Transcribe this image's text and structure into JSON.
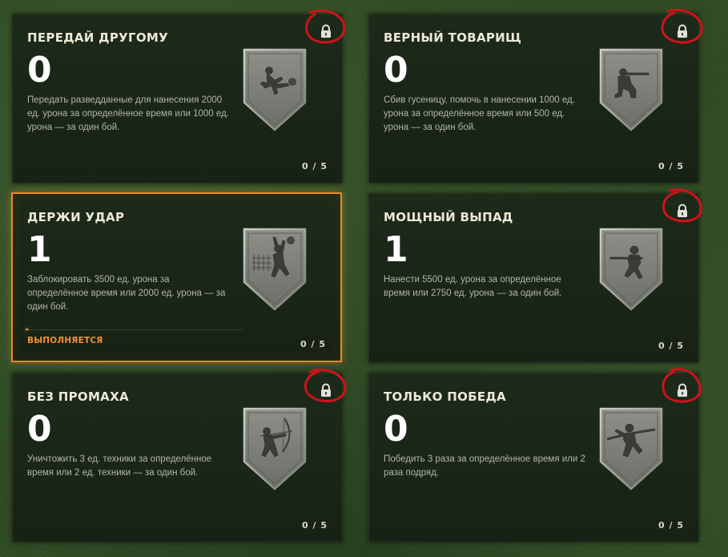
{
  "colors": {
    "background": "#2f4a24",
    "card": "#1b2718",
    "accent_active": "#e8892a",
    "status_text": "#f28f3a",
    "annotation_circle": "#d0121a"
  },
  "cards": [
    {
      "title": "ПЕРЕДАЙ ДРУГОМУ",
      "count": "0",
      "description": "Передать разведданные для нанесения 2000 ед. урона за определённое время или 1000 ед. урона — за один бой.",
      "progress": "0 / 5",
      "badge_icon": "football-kicker-icon",
      "locked": true
    },
    {
      "title": "ВЕРНЫЙ ТОВАРИЩ",
      "count": "0",
      "description": "Сбив гусеницу, помочь в нанесении 1000 ед. урона за определённое время или 500 ед. урона — за один бой.",
      "progress": "0 / 5",
      "badge_icon": "kneeling-rifleman-icon",
      "locked": true
    },
    {
      "title": "ДЕРЖИ УДАР",
      "count": "1",
      "description": "Заблокировать 3500 ед. урона за определённое время или 2000 ед. урона — за один бой.",
      "progress": "0 / 5",
      "status": "ВЫПОЛНЯЕТСЯ",
      "progress_fraction": 0.01,
      "badge_icon": "volleyball-blocker-icon",
      "locked": false,
      "active": true
    },
    {
      "title": "МОЩНЫЙ ВЫПАД",
      "count": "1",
      "description": "Нанести 5500 ед. урона за определённое время или 2750 ед. урона — за один бой.",
      "progress": "0 / 5",
      "badge_icon": "fencer-lunge-icon",
      "locked": true
    },
    {
      "title": "БЕЗ ПРОМАХА",
      "count": "0",
      "description": "Уничтожить 3 ед. техники за определённое время или 2 ед. техники — за один бой.",
      "progress": "0 / 5",
      "badge_icon": "archer-icon",
      "locked": true
    },
    {
      "title": "ТОЛЬКО ПОБЕДА",
      "count": "0",
      "description": "Победить 3 раза за определённое время или 2 раза подряд.",
      "progress": "0 / 5",
      "badge_icon": "runner-finish-icon",
      "locked": true
    }
  ]
}
